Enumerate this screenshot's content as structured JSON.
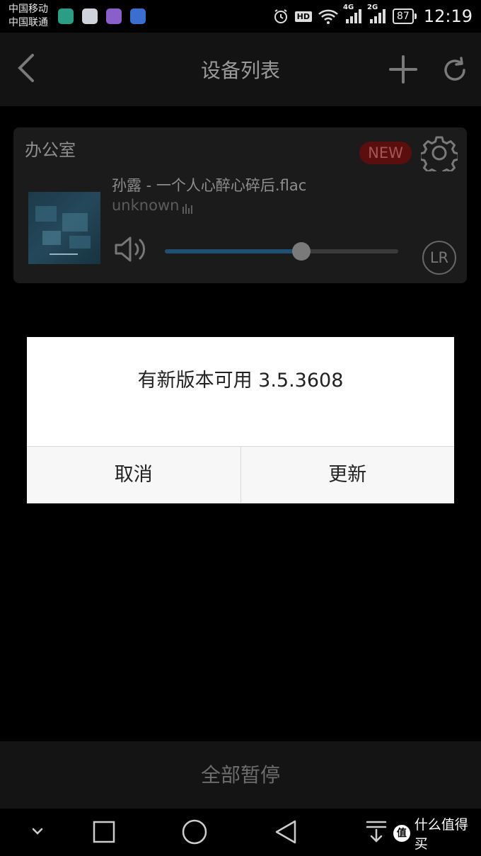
{
  "status_bar": {
    "carrier_1": "中国移动",
    "carrier_2": "中国联通",
    "hd_label": "HD",
    "net_4g": "4G",
    "net_2g": "2G",
    "battery": "87",
    "time": "12:19"
  },
  "header": {
    "title": "设备列表",
    "back_icon": "chevron-left-icon",
    "add_icon": "plus-icon",
    "refresh_icon": "refresh-icon"
  },
  "device_card": {
    "room_name": "办公室",
    "new_badge": "NEW",
    "track_title": "孙露 - 一个人心醉心碎后.flac",
    "artist": "unknown",
    "volume_level_fraction": 0.585,
    "channel_label": "LR"
  },
  "bottom_action": {
    "label": "全部暂停"
  },
  "dialog": {
    "message": "有新版本可用  3.5.3608",
    "cancel_label": "取消",
    "update_label": "更新"
  },
  "watermark": {
    "logo_char": "值",
    "text": "什么值得买"
  },
  "colors": {
    "slider_fill": "#1f4f73",
    "new_badge": "#5a0e0e",
    "dialog_bg": "#ffffff"
  }
}
